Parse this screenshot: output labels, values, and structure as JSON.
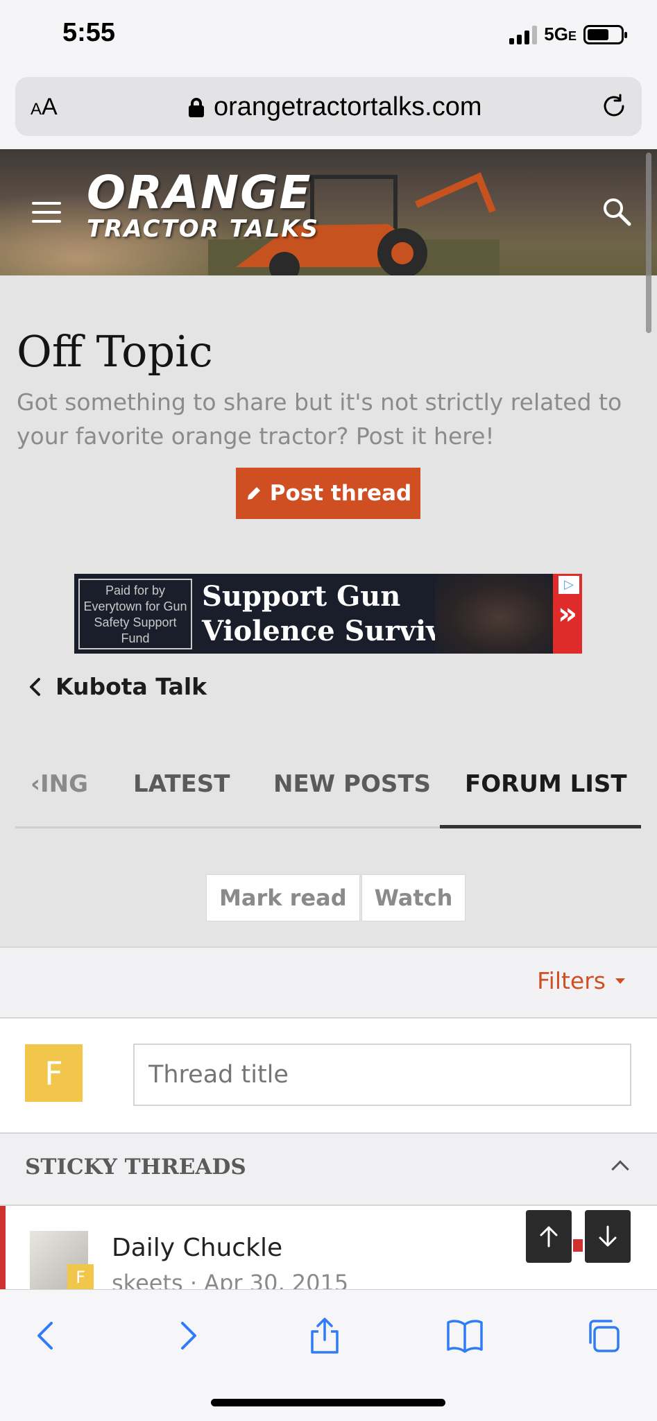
{
  "status_bar": {
    "time": "5:55",
    "network": "5G",
    "network_suffix": "E"
  },
  "browser": {
    "text_size_label": "AA",
    "domain": "orangetractortalks.com"
  },
  "header": {
    "logo_line1": "ORANGE",
    "logo_line2": "TRACTOR TALKS"
  },
  "forum": {
    "title": "Off Topic",
    "description": "Got something to share but it's not strictly related to your favorite orange tractor? Post it here!",
    "post_thread_label": "Post thread"
  },
  "ad": {
    "paid_for_by": "Paid for by Everytown for Gun Safety Support Fund",
    "headline_line1": "Support Gun",
    "headline_line2": "Violence Survivors"
  },
  "breadcrumb": {
    "parent": "Kubota Talk"
  },
  "tabs": [
    {
      "label": "‹ING"
    },
    {
      "label": "LATEST"
    },
    {
      "label": "NEW POSTS"
    },
    {
      "label": "FORUM LIST",
      "active": true
    }
  ],
  "actions": {
    "mark_read": "Mark read",
    "watch": "Watch"
  },
  "filters": {
    "label": "Filters"
  },
  "new_thread": {
    "avatar_letter": "F",
    "placeholder": "Thread title"
  },
  "sticky": {
    "heading": "STICKY THREADS",
    "threads": [
      {
        "title": "Daily Chuckle",
        "meta": "skeets · Apr 30, 2015",
        "badge": "F"
      }
    ]
  },
  "colors": {
    "accent": "#cf4f22",
    "sticky_marker": "#cf3030",
    "avatar_yellow": "#f1c64a"
  }
}
